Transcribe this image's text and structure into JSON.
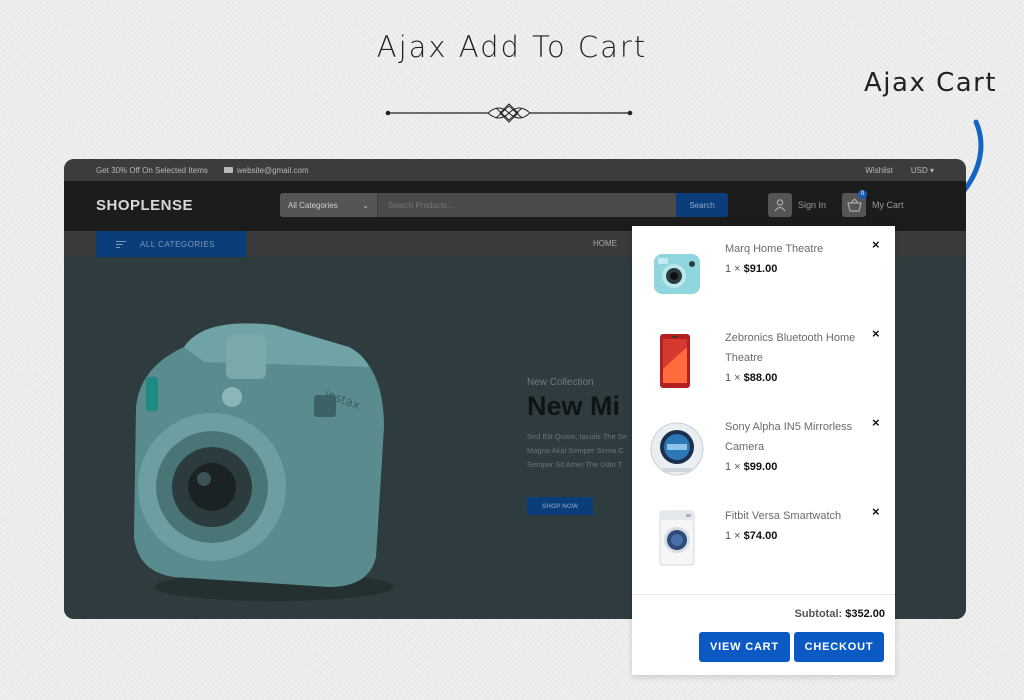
{
  "heading": "Ajax Add To Cart",
  "callout": "Ajax Cart",
  "site": {
    "topbar": {
      "promo": "Get 30% Off On Selected Items",
      "email": "website@gmail.com",
      "wishlist": "Wishlist",
      "currency": "USD"
    },
    "logo": "SHOPLENSE",
    "search": {
      "category": "All Categories",
      "placeholder": "Search Products...",
      "button": "Search"
    },
    "account": {
      "signin": "Sign In",
      "cart": "My Cart",
      "cart_count": "0"
    },
    "nav": {
      "all_categories": "ALL CATEGORIES",
      "home": "HOME"
    },
    "hero": {
      "subtitle": "New Collection",
      "title": "New Mi",
      "lines": [
        "Sed Elit Quam, Iaculis The Se",
        "Magna Akal Semper Sema C",
        "Semper Sit Amet The Udin T"
      ],
      "button": "SHOP NOW"
    }
  },
  "cart": {
    "items": [
      {
        "name": "Marq Home Theatre",
        "qty": "1 ×",
        "price": "$91.00"
      },
      {
        "name": "Zebronics Bluetooth Home Theatre",
        "qty": "1 ×",
        "price": "$88.00"
      },
      {
        "name": "Sony Alpha IN5 Mirrorless Camera",
        "qty": "1 ×",
        "price": "$99.00"
      },
      {
        "name": "Fitbit Versa Smartwatch",
        "qty": "1 ×",
        "price": "$74.00"
      }
    ],
    "remove_label": "×",
    "subtotal_label": "Subtotal:",
    "subtotal_value": "$352.00",
    "view_cart": "VIEW CART",
    "checkout": "CHECKOUT"
  },
  "colors": {
    "accent": "#0b5ac4",
    "arrow": "#1565c0"
  },
  "icons": [
    "ornament-divider-icon",
    "curved-arrow-icon",
    "mail-icon",
    "user-icon",
    "basket-icon",
    "menu-icon",
    "chevron-down-icon",
    "close-icon"
  ]
}
